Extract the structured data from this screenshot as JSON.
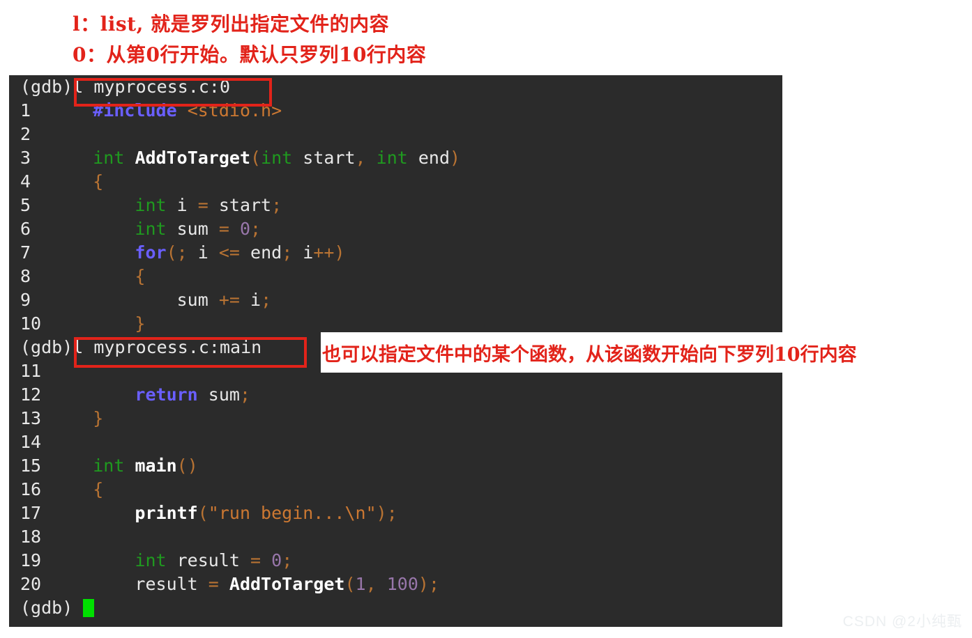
{
  "annotations": {
    "top_line_1": "l：list, 就是罗列出指定文件的内容",
    "top_line_2": "0：从第0行开始。默认只罗列10行内容",
    "side_note": "也可以指定文件中的某个函数，从该函数开始向下罗列10行内容"
  },
  "terminal": {
    "prompt": "(gdb)",
    "commands": {
      "first": "l myprocess.c:0",
      "second": "l myprocess.c:main"
    },
    "lines": [
      {
        "no": "1",
        "indent": 2,
        "tokens": [
          {
            "t": "#include",
            "c": "kw"
          },
          {
            "t": " ",
            "c": "plain"
          },
          {
            "t": "<stdio.h>",
            "c": "str"
          }
        ]
      },
      {
        "no": "2",
        "indent": 0,
        "tokens": []
      },
      {
        "no": "3",
        "indent": 2,
        "tokens": [
          {
            "t": "int",
            "c": "type"
          },
          {
            "t": " ",
            "c": "plain"
          },
          {
            "t": "AddToTarget",
            "c": "fn"
          },
          {
            "t": "(",
            "c": "punc"
          },
          {
            "t": "int",
            "c": "type"
          },
          {
            "t": " start",
            "c": "plain"
          },
          {
            "t": ",",
            "c": "punc"
          },
          {
            "t": " ",
            "c": "plain"
          },
          {
            "t": "int",
            "c": "type"
          },
          {
            "t": " end",
            "c": "plain"
          },
          {
            "t": ")",
            "c": "punc"
          }
        ]
      },
      {
        "no": "4",
        "indent": 2,
        "tokens": [
          {
            "t": "{",
            "c": "punc"
          }
        ]
      },
      {
        "no": "5",
        "indent": 4,
        "tokens": [
          {
            "t": "int",
            "c": "type"
          },
          {
            "t": " i ",
            "c": "plain"
          },
          {
            "t": "=",
            "c": "punc"
          },
          {
            "t": " start",
            "c": "plain"
          },
          {
            "t": ";",
            "c": "punc"
          }
        ]
      },
      {
        "no": "6",
        "indent": 4,
        "tokens": [
          {
            "t": "int",
            "c": "type"
          },
          {
            "t": " sum ",
            "c": "plain"
          },
          {
            "t": "=",
            "c": "punc"
          },
          {
            "t": " ",
            "c": "plain"
          },
          {
            "t": "0",
            "c": "num"
          },
          {
            "t": ";",
            "c": "punc"
          }
        ]
      },
      {
        "no": "7",
        "indent": 4,
        "tokens": [
          {
            "t": "for",
            "c": "kw"
          },
          {
            "t": "(",
            "c": "punc"
          },
          {
            "t": ";",
            "c": "punc"
          },
          {
            "t": " i ",
            "c": "plain"
          },
          {
            "t": "<=",
            "c": "punc"
          },
          {
            "t": " end",
            "c": "plain"
          },
          {
            "t": ";",
            "c": "punc"
          },
          {
            "t": " i",
            "c": "plain"
          },
          {
            "t": "++",
            "c": "punc"
          },
          {
            "t": ")",
            "c": "punc"
          }
        ]
      },
      {
        "no": "8",
        "indent": 4,
        "tokens": [
          {
            "t": "{",
            "c": "punc"
          }
        ]
      },
      {
        "no": "9",
        "indent": 6,
        "tokens": [
          {
            "t": "sum ",
            "c": "plain"
          },
          {
            "t": "+=",
            "c": "punc"
          },
          {
            "t": " i",
            "c": "plain"
          },
          {
            "t": ";",
            "c": "punc"
          }
        ]
      },
      {
        "no": "10",
        "indent": 4,
        "tokens": [
          {
            "t": "}",
            "c": "punc"
          }
        ]
      },
      {
        "no": "11",
        "indent": 0,
        "tokens": []
      },
      {
        "no": "12",
        "indent": 4,
        "tokens": [
          {
            "t": "return",
            "c": "kw"
          },
          {
            "t": " sum",
            "c": "plain"
          },
          {
            "t": ";",
            "c": "punc"
          }
        ]
      },
      {
        "no": "13",
        "indent": 2,
        "tokens": [
          {
            "t": "}",
            "c": "punc"
          }
        ]
      },
      {
        "no": "14",
        "indent": 0,
        "tokens": []
      },
      {
        "no": "15",
        "indent": 2,
        "tokens": [
          {
            "t": "int",
            "c": "type"
          },
          {
            "t": " ",
            "c": "plain"
          },
          {
            "t": "main",
            "c": "fn"
          },
          {
            "t": "()",
            "c": "punc"
          }
        ]
      },
      {
        "no": "16",
        "indent": 2,
        "tokens": [
          {
            "t": "{",
            "c": "punc"
          }
        ]
      },
      {
        "no": "17",
        "indent": 4,
        "tokens": [
          {
            "t": "printf",
            "c": "fn"
          },
          {
            "t": "(",
            "c": "punc"
          },
          {
            "t": "\"run begin...\\n\"",
            "c": "str"
          },
          {
            "t": ")",
            "c": "punc"
          },
          {
            "t": ";",
            "c": "punc"
          }
        ]
      },
      {
        "no": "18",
        "indent": 0,
        "tokens": []
      },
      {
        "no": "19",
        "indent": 4,
        "tokens": [
          {
            "t": "int",
            "c": "type"
          },
          {
            "t": " result ",
            "c": "plain"
          },
          {
            "t": "=",
            "c": "punc"
          },
          {
            "t": " ",
            "c": "plain"
          },
          {
            "t": "0",
            "c": "num"
          },
          {
            "t": ";",
            "c": "punc"
          }
        ]
      },
      {
        "no": "20",
        "indent": 4,
        "tokens": [
          {
            "t": "result ",
            "c": "plain"
          },
          {
            "t": "=",
            "c": "punc"
          },
          {
            "t": " ",
            "c": "plain"
          },
          {
            "t": "AddToTarget",
            "c": "fn"
          },
          {
            "t": "(",
            "c": "punc"
          },
          {
            "t": "1",
            "c": "num"
          },
          {
            "t": ",",
            "c": "punc"
          },
          {
            "t": " ",
            "c": "plain"
          },
          {
            "t": "100",
            "c": "num"
          },
          {
            "t": ")",
            "c": "punc"
          },
          {
            "t": ";",
            "c": "punc"
          }
        ]
      }
    ]
  },
  "watermark": "CSDN @2小纯甄",
  "colors": {
    "annotation_red": "#e2231a",
    "terminal_bg": "#2b2b2b",
    "terminal_fg": "#e8e8e8",
    "cursor_green": "#00e000",
    "keyword": "#6a5fff",
    "type": "#1f9a1f",
    "punctuation": "#b87333",
    "string": "#cc7832",
    "number": "#9876aa"
  }
}
